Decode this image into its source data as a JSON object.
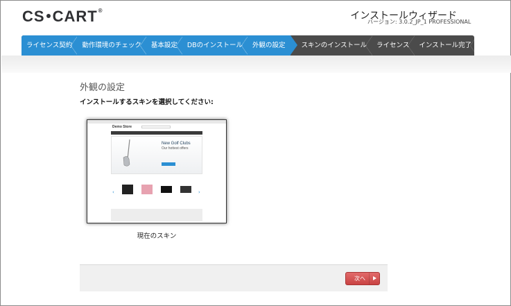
{
  "header": {
    "logo_text_1": "CS",
    "logo_text_2": "CART",
    "logo_reg": "®",
    "wizard_title": "インストールウィザード",
    "version": "バージョン: 3.0.2_JP_1 PROFESSIONAL"
  },
  "steps": [
    {
      "label": "ライセンス契約",
      "state": "done"
    },
    {
      "label": "動作環境のチェック",
      "state": "done"
    },
    {
      "label": "基本設定",
      "state": "done"
    },
    {
      "label": "DBのインストール",
      "state": "done"
    },
    {
      "label": "外観の設定",
      "state": "current"
    },
    {
      "label": "スキンのインストール",
      "state": "todo"
    },
    {
      "label": "ライセンス",
      "state": "todo"
    },
    {
      "label": "インストール完了",
      "state": "todo"
    }
  ],
  "main": {
    "title": "外観の設定",
    "subtitle": "インストールするスキンを選択してください:",
    "skin": {
      "caption": "現在のスキン",
      "preview": {
        "store_name": "Demo Store",
        "banner_heading": "New Golf Clubs",
        "banner_sub": "Our hottest offers"
      }
    }
  },
  "footer": {
    "next_label": "次へ"
  },
  "colors": {
    "step_done": "#2b8fd3",
    "step_todo": "#4b4b4b",
    "next_button": "#d45656"
  }
}
